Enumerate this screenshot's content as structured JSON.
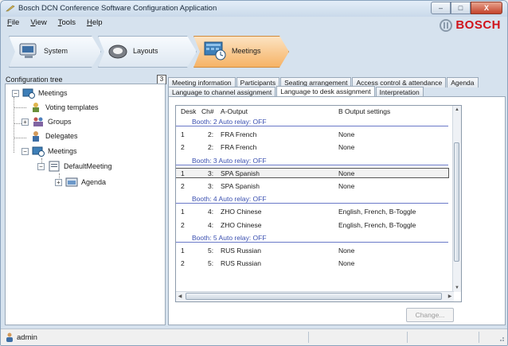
{
  "window": {
    "title": "Bosch DCN Conference Software Configuration Application",
    "minimize_label": "–",
    "maximize_label": "□",
    "close_label": "X"
  },
  "menu": [
    {
      "underline": "F",
      "rest": "ile"
    },
    {
      "underline": "V",
      "rest": "iew"
    },
    {
      "underline": "T",
      "rest": "ools"
    },
    {
      "underline": "H",
      "rest": "elp"
    }
  ],
  "brand": {
    "name": "BOSCH"
  },
  "navigation": {
    "steps": [
      {
        "label": "System",
        "icon": "system-icon",
        "active": false
      },
      {
        "label": "Layouts",
        "icon": "layouts-icon",
        "active": false
      },
      {
        "label": "Meetings",
        "icon": "meetings-icon",
        "active": true
      }
    ]
  },
  "config_tree": {
    "label": "Configuration tree",
    "count": "3",
    "nodes": [
      {
        "label": "Meetings",
        "toggle": "−",
        "icon": "meetings-tree-icon"
      },
      {
        "label": "Voting templates",
        "toggle": "",
        "icon": "voting-icon"
      },
      {
        "label": "Groups",
        "toggle": "+",
        "icon": "groups-icon"
      },
      {
        "label": "Delegates",
        "toggle": "",
        "icon": "delegates-icon"
      },
      {
        "label": "Meetings",
        "toggle": "−",
        "icon": "meetings-tree-icon"
      },
      {
        "label": "DefaultMeeting",
        "toggle": "−",
        "icon": "meeting-doc-icon"
      },
      {
        "label": "Agenda",
        "toggle": "+",
        "icon": "agenda-icon"
      }
    ]
  },
  "tabs": {
    "row1": [
      "Meeting information",
      "Participants",
      "Seating arrangement",
      "Access control & attendance",
      "Agenda"
    ],
    "row2": [
      "Language to channel assignment",
      "Language to desk assignment",
      "Interpretation"
    ],
    "active": "Language to desk assignment"
  },
  "grid": {
    "columns": [
      "Desk",
      "Ch#",
      "A-Output",
      "B Output settings"
    ],
    "rows": [
      {
        "type": "group",
        "label": "Booth: 2 Auto relay: OFF"
      },
      {
        "type": "row",
        "desk": "1",
        "ch": "2:",
        "a_output": "FRA French",
        "b_output": "None"
      },
      {
        "type": "row",
        "desk": "2",
        "ch": "2:",
        "a_output": "FRA French",
        "b_output": "None"
      },
      {
        "type": "group",
        "label": "Booth: 3 Auto relay: OFF"
      },
      {
        "type": "row",
        "desk": "1",
        "ch": "3:",
        "a_output": "SPA Spanish",
        "b_output": "None",
        "selected": true
      },
      {
        "type": "row",
        "desk": "2",
        "ch": "3:",
        "a_output": "SPA Spanish",
        "b_output": "None"
      },
      {
        "type": "group",
        "label": "Booth: 4 Auto relay: OFF"
      },
      {
        "type": "row",
        "desk": "1",
        "ch": "4:",
        "a_output": "ZHO Chinese",
        "b_output": "English, French, B-Toggle"
      },
      {
        "type": "row",
        "desk": "2",
        "ch": "4:",
        "a_output": "ZHO Chinese",
        "b_output": "English, French, B-Toggle"
      },
      {
        "type": "group",
        "label": "Booth: 5 Auto relay: OFF"
      },
      {
        "type": "row",
        "desk": "1",
        "ch": "5:",
        "a_output": "RUS Russian",
        "b_output": "None"
      },
      {
        "type": "row",
        "desk": "2",
        "ch": "5:",
        "a_output": "RUS Russian",
        "b_output": "None"
      }
    ]
  },
  "change_button": "Change...",
  "status": {
    "user": "admin"
  }
}
